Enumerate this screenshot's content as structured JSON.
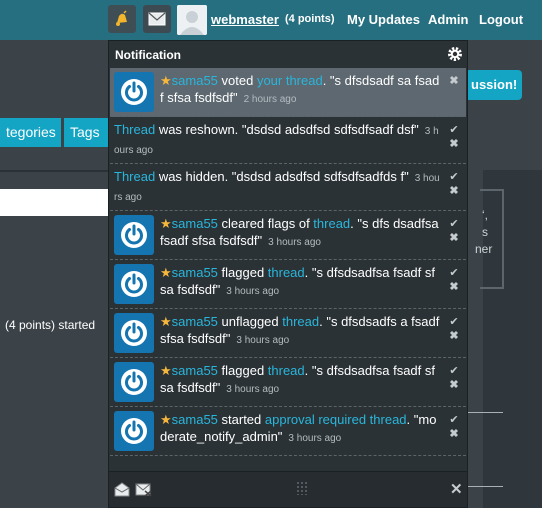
{
  "header": {
    "username": "webmaster",
    "points": "(4 points)",
    "my_updates": "My Updates",
    "admin": "Admin",
    "logout": "Logout"
  },
  "background": {
    "categories": "tegories",
    "tags": "Tags",
    "discussion_button": "ussion!",
    "started_text": "(4 points) started",
    "right_fragment_1": "‘,",
    "right_fragment_2": "s",
    "right_fragment_3": "ner"
  },
  "notification": {
    "title": "Notification",
    "items": [
      {
        "user": "sama55",
        "verb": " voted ",
        "link": "your thread",
        "rest": ". \"s dfsdsadf sa fsadf sfsa fsdfsdf\"",
        "time": "2 hours ago",
        "has_avatar": true
      },
      {
        "user": "",
        "verb": "",
        "link": "Thread",
        "rest": " was reshown. \"dsdsd adsdfsd sdfsdfsadf dsf\"",
        "time": "3 hours ago",
        "has_avatar": false
      },
      {
        "user": "",
        "verb": "",
        "link": "Thread",
        "rest": " was hidden. \"dsdsd adsdfsd sdfsdfsadfds f\"",
        "time": "3 hours ago",
        "has_avatar": false
      },
      {
        "user": "sama55",
        "verb": " cleared flags of ",
        "link": "thread",
        "rest": ". \"s dfs dsadfsa fsadf sfsa fsdfsdf\"",
        "time": "3 hours ago",
        "has_avatar": true
      },
      {
        "user": "sama55",
        "verb": " flagged ",
        "link": "thread",
        "rest": ". \"s dfsdsadfsa fsadf sfsa fsdfsdf\"",
        "time": "3 hours ago",
        "has_avatar": true
      },
      {
        "user": "sama55",
        "verb": " unflagged ",
        "link": "thread",
        "rest": ". \"s dfsdsadfs a fsadf sfsa fsdfsdf\"",
        "time": "3 hours ago",
        "has_avatar": true
      },
      {
        "user": "sama55",
        "verb": " flagged ",
        "link": "thread",
        "rest": ". \"s dfsdsadfsa fsadf sfsa fsdfsdf\"",
        "time": "3 hours ago",
        "has_avatar": true
      },
      {
        "user": "sama55",
        "verb": " started ",
        "link": "approval required thread",
        "rest": ". \"moderate_notify_admin\"",
        "time": "3 hours ago",
        "has_avatar": true
      }
    ]
  },
  "colors": {
    "accent": "#13a5c3",
    "link": "#29b6dc",
    "star": "#f6b73c",
    "panel": "#2b3236"
  },
  "icons": [
    "bell-icon",
    "mail-icon",
    "gear-icon",
    "check-icon",
    "close-icon",
    "power-icon",
    "star-icon",
    "mark-read-icon",
    "mark-all-icon",
    "resize-grip-icon"
  ]
}
